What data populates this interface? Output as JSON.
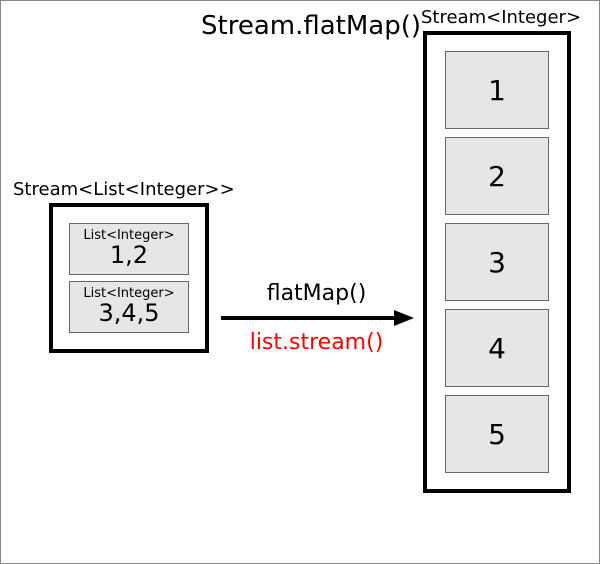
{
  "title": "Stream.flatMap()",
  "source": {
    "label": "Stream<List<Integer>>",
    "items": [
      {
        "type_label": "List<Integer>",
        "value_text": "1,2"
      },
      {
        "type_label": "List<Integer>",
        "value_text": "3,4,5"
      }
    ]
  },
  "destination": {
    "label": "Stream<Integer>",
    "items": [
      "1",
      "2",
      "3",
      "4",
      "5"
    ]
  },
  "arrow": {
    "top_label": "flatMap()",
    "bottom_label": "list.stream()",
    "bottom_color": "#ff0000"
  },
  "chart_data": {
    "type": "diagram",
    "operation": "Stream.flatMap()",
    "input_type": "Stream<List<Integer>>",
    "output_type": "Stream<Integer>",
    "mapper": "list.stream()",
    "input": [
      [
        1,
        2
      ],
      [
        3,
        4,
        5
      ]
    ],
    "output": [
      1,
      2,
      3,
      4,
      5
    ]
  }
}
